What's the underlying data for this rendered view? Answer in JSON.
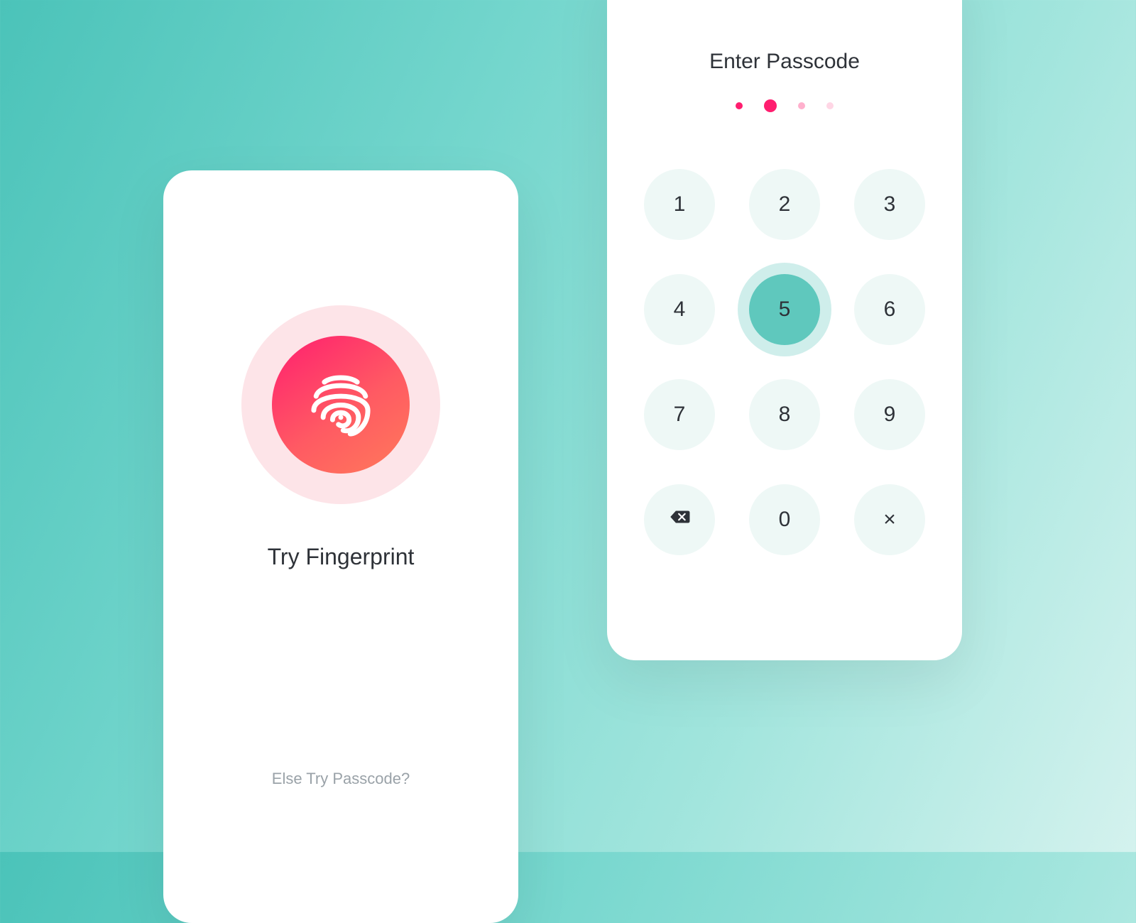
{
  "fingerprint": {
    "title": "Try Fingerprint",
    "footer_link": "Else Try Passcode?",
    "icon": "fingerprint-icon"
  },
  "passcode": {
    "title": "Enter Passcode",
    "digits_total": 4,
    "digits_entered": 2,
    "active_key": "5",
    "keypad": {
      "rows": [
        [
          "1",
          "2",
          "3"
        ],
        [
          "4",
          "5",
          "6"
        ],
        [
          "7",
          "8",
          "9"
        ]
      ],
      "bottom": {
        "left_action": "backspace",
        "zero": "0",
        "right_action": "cancel",
        "cancel_glyph": "×"
      }
    }
  },
  "colors": {
    "accent_pink": "#ff1e6f",
    "accent_teal": "#5fc8bd",
    "key_bg": "#eef8f6"
  }
}
